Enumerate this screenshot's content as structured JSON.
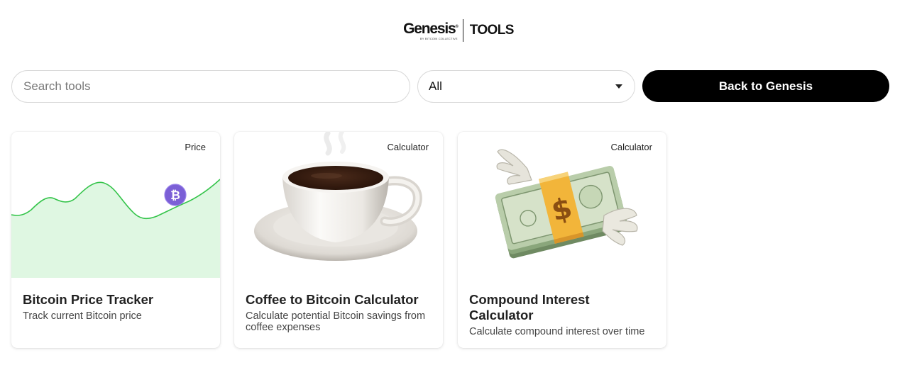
{
  "header": {
    "brand": "Genesis",
    "brand_mark": "®",
    "brand_sub": "BY BITCOIN COLLECTIVE",
    "section": "TOOLS"
  },
  "toolbar": {
    "search_placeholder": "Search tools",
    "search_value": "",
    "filter_value": "All",
    "back_label": "Back to Genesis"
  },
  "cards": [
    {
      "badge": "Price",
      "title": "Bitcoin Price Tracker",
      "description": "Track current Bitcoin price",
      "image": "price-chart-illustration"
    },
    {
      "badge": "Calculator",
      "title": "Coffee to Bitcoin Calculator",
      "description": "Calculate potential Bitcoin savings from coffee expenses",
      "image": "coffee-cup-emoji"
    },
    {
      "badge": "Calculator",
      "title": "Compound Interest Calculator",
      "description": "Calculate compound interest over time",
      "image": "money-with-wings-emoji"
    }
  ],
  "colors": {
    "chart_fill": "#dff7e2",
    "chart_line": "#34c44a",
    "coin": "#7b5fd6",
    "button": "#000000"
  }
}
